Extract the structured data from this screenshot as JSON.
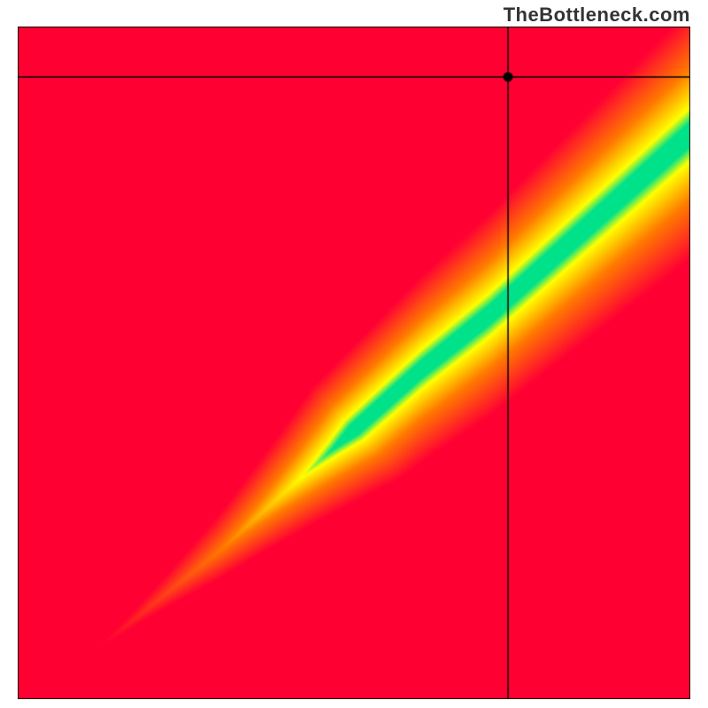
{
  "watermark": "TheBottleneck.com",
  "chart_data": {
    "type": "heatmap",
    "title": "",
    "xlabel": "",
    "ylabel": "",
    "xlim": [
      0,
      1
    ],
    "ylim": [
      0,
      1
    ],
    "crosshair": {
      "x": 0.73,
      "y": 0.925
    },
    "marker": {
      "x": 0.73,
      "y": 0.925
    },
    "curve": {
      "description": "optimal-match ridge",
      "points": [
        [
          0.0,
          0.0
        ],
        [
          0.1,
          0.06
        ],
        [
          0.2,
          0.14
        ],
        [
          0.3,
          0.22
        ],
        [
          0.4,
          0.31
        ],
        [
          0.5,
          0.4
        ],
        [
          0.6,
          0.49
        ],
        [
          0.7,
          0.57
        ],
        [
          0.8,
          0.66
        ],
        [
          0.9,
          0.75
        ],
        [
          1.0,
          0.84
        ]
      ]
    },
    "bands": {
      "green_halfwidth": 0.05,
      "yellow_halfwidth": 0.14
    },
    "palette": {
      "red": "#ff0033",
      "orange": "#ff7a00",
      "yellow": "#ffff00",
      "green": "#00e28a"
    }
  }
}
